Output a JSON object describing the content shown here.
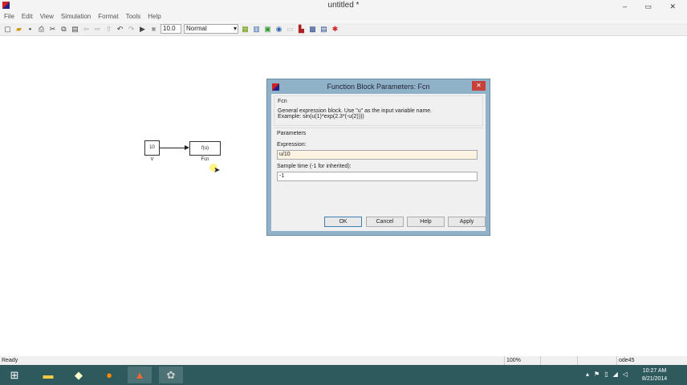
{
  "window": {
    "title": "untitled *",
    "controls": "– ▭ ✕"
  },
  "menu": [
    "File",
    "Edit",
    "View",
    "Simulation",
    "Format",
    "Tools",
    "Help"
  ],
  "toolbar": {
    "stop_time": "10.0",
    "mode": "Normal"
  },
  "model": {
    "constant": {
      "value": "10",
      "name": "V"
    },
    "fcn": {
      "value": "f(u)",
      "name": "Fcn"
    }
  },
  "dialog": {
    "title": "Function Block Parameters: Fcn",
    "block_type": "Fcn",
    "description": "General expression block. Use \"u\" as the input variable name.",
    "example": "Example: sin(u(1)*exp(2.3*(-u(2))))",
    "parameters_label": "Parameters",
    "expression_label": "Expression:",
    "expression_value": "u/10",
    "sample_label": "Sample time (-1 for inherited):",
    "sample_value": "-1",
    "ok": "OK",
    "cancel": "Cancel",
    "help": "Help",
    "apply": "Apply"
  },
  "status": {
    "ready": "Ready",
    "zoom": "100%",
    "solver": "ode45"
  },
  "taskbar": {
    "time": "10:27 AM",
    "date": "8/21/2014"
  }
}
